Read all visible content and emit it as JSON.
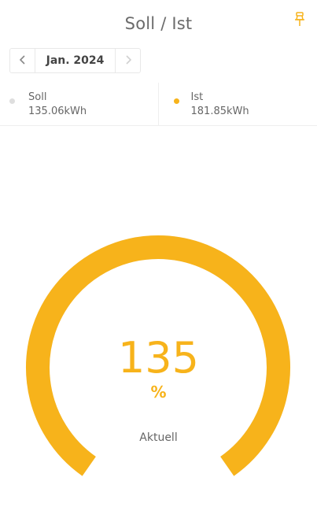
{
  "header": {
    "title": "Soll / Ist",
    "pin_icon": "pin-icon"
  },
  "period": {
    "label": "Jan. 2024",
    "prev_icon": "chevron-left-icon",
    "next_icon": "chevron-right-icon"
  },
  "legend": [
    {
      "name": "Soll",
      "value": "135.06kWh",
      "color": "#dedede"
    },
    {
      "name": "Ist",
      "value": "181.85kWh",
      "color": "#f7b31b"
    }
  ],
  "gauge": {
    "value": "135",
    "unit": "%",
    "label": "Aktuell",
    "fill_fraction": 1.0,
    "color": "#f7b31b"
  }
}
